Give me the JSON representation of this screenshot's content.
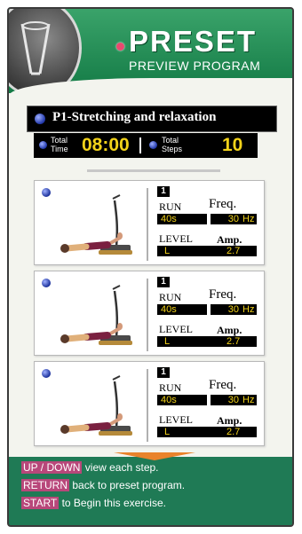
{
  "header": {
    "title": "PRESET",
    "subtitle": "PREVIEW PROGRAM",
    "logo_icon": "machine-logo-icon"
  },
  "program": {
    "name": "P1-Stretching and relaxation",
    "total_time_label_top": "Total",
    "total_time_label_bottom": "Time",
    "total_time": "08:00",
    "total_steps_label_top": "Total",
    "total_steps_label_bottom": "Steps",
    "total_steps": "10"
  },
  "steps": [
    {
      "number": "1",
      "run_label": "RUN",
      "run_value": "40s",
      "freq_label": "Freq.",
      "freq_value": "30",
      "freq_unit": "Hz",
      "level_label": "LEVEL",
      "level_value": "L",
      "amp_label": "Amp.",
      "amp_value": "2.7"
    },
    {
      "number": "1",
      "run_label": "RUN",
      "run_value": "40s",
      "freq_label": "Freq.",
      "freq_value": "30",
      "freq_unit": "Hz",
      "level_label": "LEVEL",
      "level_value": "L",
      "amp_label": "Amp.",
      "amp_value": "2.7"
    },
    {
      "number": "1",
      "run_label": "RUN",
      "run_value": "40s",
      "freq_label": "Freq.",
      "freq_value": "30",
      "freq_unit": "Hz",
      "level_label": "LEVEL",
      "level_value": "L",
      "amp_label": "Amp.",
      "amp_value": "2.7"
    }
  ],
  "help": [
    {
      "key": "UP / DOWN",
      "text": "view each step."
    },
    {
      "key": "RETURN",
      "text": "back to preset program."
    },
    {
      "key": "START",
      "text": "to Begin this exercise."
    }
  ],
  "colors": {
    "brand_green": "#1f7a55",
    "value_yellow": "#f2d21a",
    "key_magenta": "#b8477a"
  }
}
